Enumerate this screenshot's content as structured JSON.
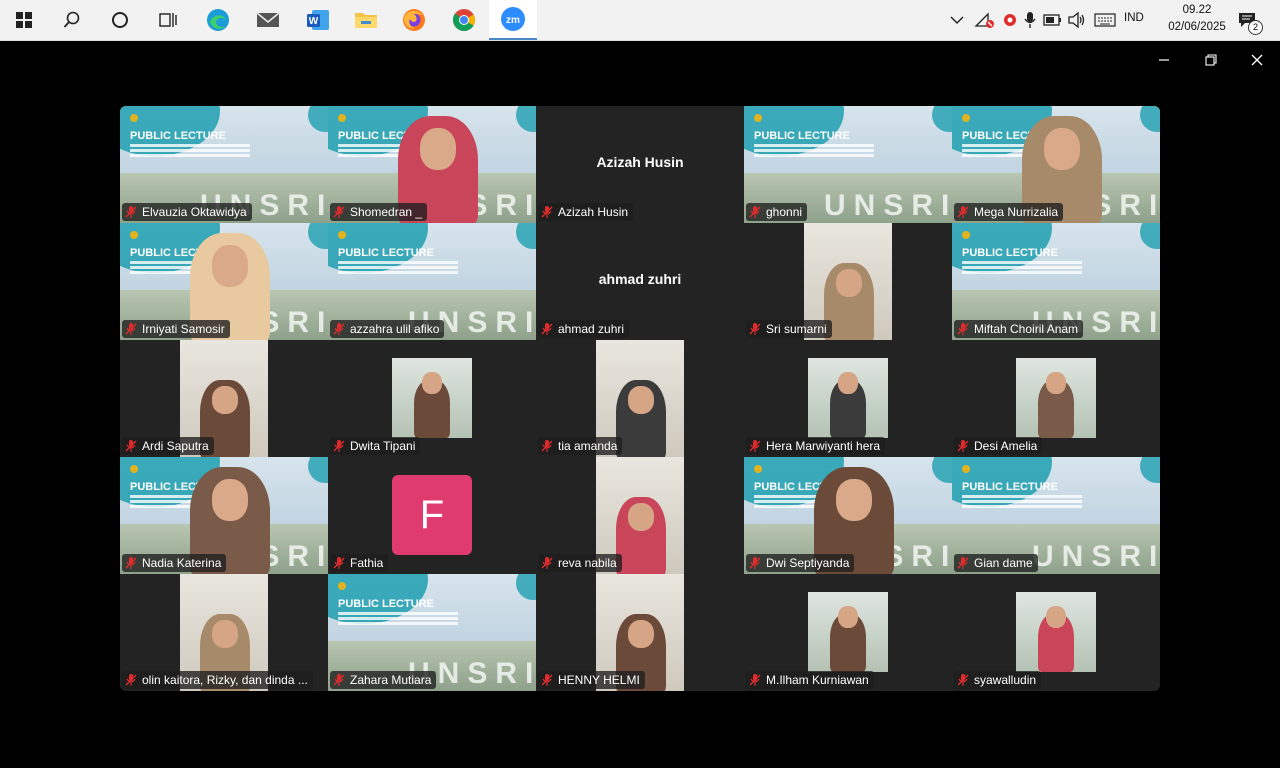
{
  "taskbar": {
    "apps": [
      {
        "icon": "windows-start-icon"
      },
      {
        "icon": "search-icon"
      },
      {
        "icon": "cortana-icon"
      },
      {
        "icon": "task-view-icon"
      },
      {
        "icon": "edge-icon"
      },
      {
        "icon": "mail-icon"
      },
      {
        "icon": "word-icon"
      },
      {
        "icon": "file-explorer-icon"
      },
      {
        "icon": "firefox-icon"
      },
      {
        "icon": "chrome-icon"
      },
      {
        "icon": "zoom-icon",
        "label": "zm"
      }
    ],
    "language": "IND",
    "time": "09.22",
    "date": "02/06/2025",
    "notification_count": "2"
  },
  "participants": [
    {
      "name": "Elvauzia Oktawidya",
      "view": "poster"
    },
    {
      "name": "Shomedran _",
      "view": "poster-person"
    },
    {
      "name": "Azizah Husin",
      "view": "name",
      "display_name": "Azizah Husin"
    },
    {
      "name": "ghonni",
      "view": "poster"
    },
    {
      "name": "Mega Nurrizalia",
      "view": "poster-person",
      "active": true
    },
    {
      "name": "Irniyati Samosir",
      "view": "poster-person"
    },
    {
      "name": "azzahra ulil afiko",
      "view": "poster"
    },
    {
      "name": "ahmad zuhri",
      "view": "name",
      "display_name": "ahmad zuhri"
    },
    {
      "name": "Sri sumarni",
      "view": "camera"
    },
    {
      "name": "Miftah Choiril Anam",
      "view": "poster"
    },
    {
      "name": "Ardi Saputra",
      "view": "camera"
    },
    {
      "name": "Dwita Tipani",
      "view": "photo"
    },
    {
      "name": "tia amanda",
      "view": "camera"
    },
    {
      "name": "Hera Marwiyanti hera",
      "view": "photo"
    },
    {
      "name": "Desi Amelia",
      "view": "photo"
    },
    {
      "name": "Nadia Katerina",
      "view": "poster-person"
    },
    {
      "name": "Fathia",
      "view": "avatar",
      "initial": "F"
    },
    {
      "name": "reva nabila",
      "view": "camera"
    },
    {
      "name": "Dwi Septiyanda",
      "view": "poster-person"
    },
    {
      "name": "Gian dame",
      "view": "poster"
    },
    {
      "name": "olin kaitora, Rizky, dan dinda ...",
      "view": "camera"
    },
    {
      "name": "Zahara Mutiara",
      "view": "poster"
    },
    {
      "name": "HENNY HELMI",
      "view": "camera"
    },
    {
      "name": "M.Ilham Kurniawan",
      "view": "photo"
    },
    {
      "name": "syawalludin",
      "view": "photo"
    }
  ],
  "poster": {
    "title": "PUBLIC LECTURE",
    "watermark": "UNSRI"
  },
  "colors": {
    "accent_teal": "#1e9fb0",
    "active_speaker": "#23d86b",
    "mic_muted": "#e02b2b",
    "avatar_pink": "#e03b6f"
  }
}
